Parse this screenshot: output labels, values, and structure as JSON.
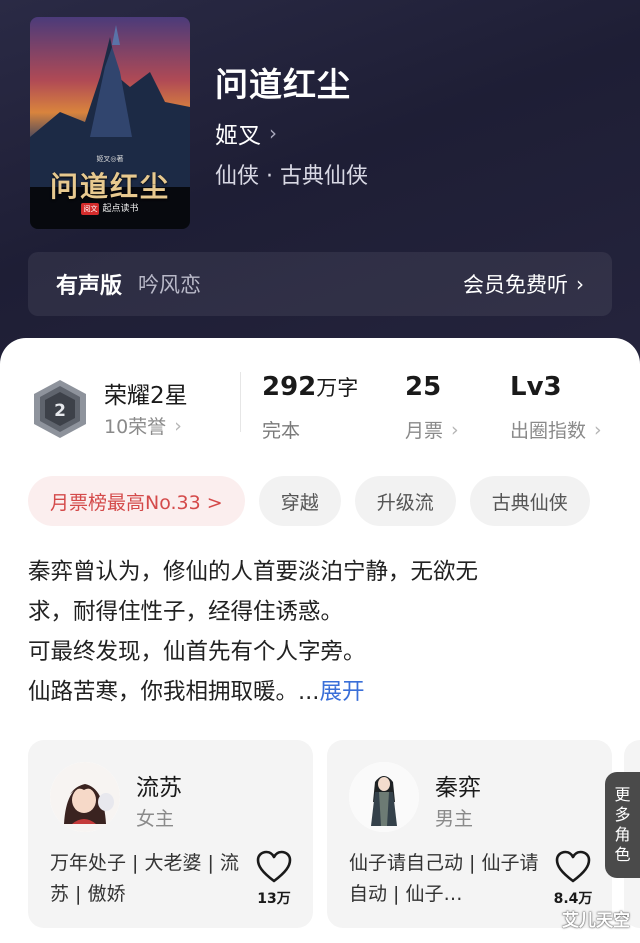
{
  "book": {
    "title": "问道红尘",
    "author": "姬叉",
    "genre": "仙侠 · 古典仙侠",
    "cover": {
      "title": "问道红尘",
      "author_line": "姬叉◎著",
      "publisher_tag": "阅文",
      "publisher": "起点读书"
    }
  },
  "audio": {
    "label": "有声版",
    "reader": "吟风恋",
    "free_label": "会员免费听"
  },
  "stats": {
    "honor": {
      "title": "荣耀2星",
      "sub": "10荣誉",
      "badge_num": "2"
    },
    "words": {
      "value": "292",
      "unit": "万字",
      "sub": "完本"
    },
    "monthly": {
      "value": "25",
      "sub": "月票"
    },
    "level": {
      "value": "Lv3",
      "sub": "出圈指数"
    }
  },
  "chips": [
    "月票榜最高No.33 >",
    "穿越",
    "升级流",
    "古典仙侠"
  ],
  "description": {
    "lines": [
      "秦弈曾认为，修仙的人首要淡泊宁静，无欲无",
      "求，耐得住性子，经得住诱惑。",
      "可最终发现，仙首先有个人字旁。",
      "仙路苦寒，你我相拥取暖。..."
    ],
    "expand": "展开"
  },
  "characters": [
    {
      "name": "流苏",
      "role": "女主",
      "tags": "万年处子 | 大老婆 | 流苏 | 傲娇",
      "likes": "13万"
    },
    {
      "name": "秦弈",
      "role": "男主",
      "tags": "仙子请自己动 | 仙子请自动 | 仙子…",
      "likes": "8.4万"
    }
  ],
  "more_roles": [
    "更",
    "多",
    "角",
    "色"
  ],
  "watermark": "艾儿天空",
  "colors": {
    "hero_bg": "#23233c",
    "rank_chip_text": "#d44a4a",
    "expand_link": "#3a6fd8"
  },
  "icons": [
    "chevron-right-icon",
    "heart-icon",
    "honor-badge-icon"
  ]
}
